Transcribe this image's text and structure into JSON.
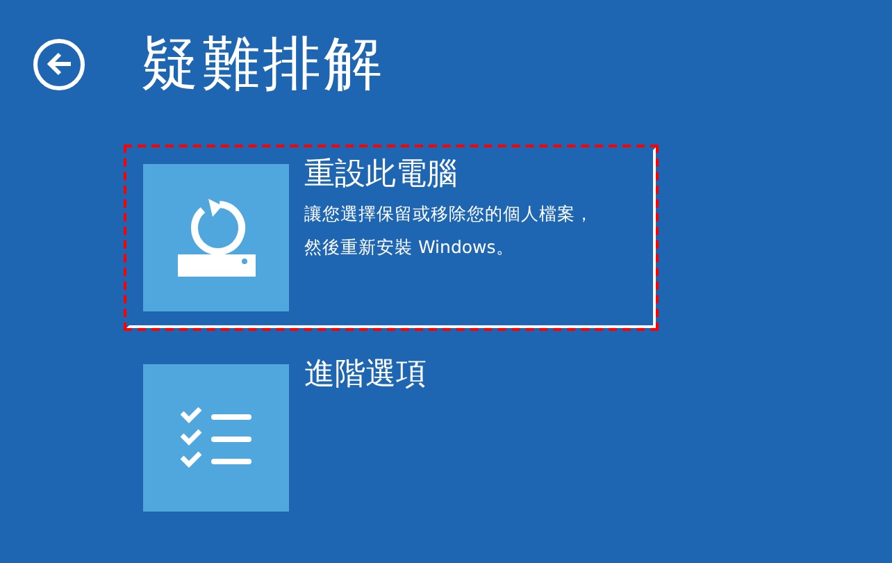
{
  "header": {
    "title": "疑難排解"
  },
  "options": [
    {
      "kind": "reset",
      "title": "重設此電腦",
      "description": [
        "讓您選擇保留或移除您的個人檔案，",
        "然後重新安裝 Windows。"
      ],
      "selected": true
    },
    {
      "kind": "advanced",
      "title": "進階選項",
      "selected": false
    }
  ]
}
